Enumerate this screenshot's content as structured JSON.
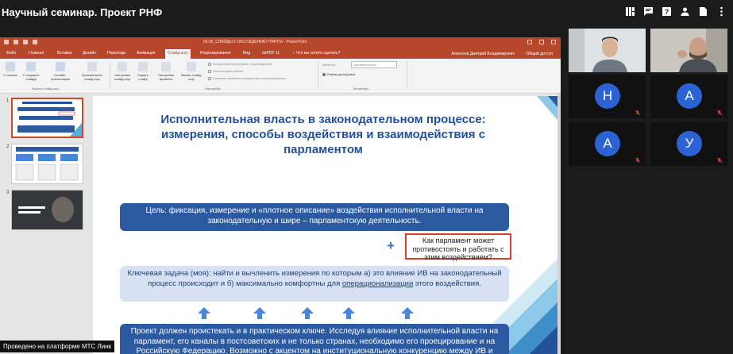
{
  "meeting": {
    "title": "Научный семинар. Проект РНФ",
    "footer": "Проведено на платформе МТС Линк"
  },
  "top_icons": [
    "grid-icon",
    "chat-icon",
    "help-icon",
    "user-icon",
    "document-icon",
    "more-icon"
  ],
  "powerpoint": {
    "document_title": "05.05_СЛАЙДЫ К ОБСУЖДЕНИЮ ГРАНТА - PowerPoint",
    "tabs": [
      "Файл",
      "Главная",
      "Вставка",
      "Дизайн",
      "Переходы",
      "Анимация",
      "Слайд-шоу",
      "Рецензирование",
      "Вид",
      "doPDF 11",
      "♀ Что вы хотите сделать?"
    ],
    "active_tab": "Слайд-шоу",
    "user": "Алексеев Дмитрий Владимирович",
    "share": "Общий доступ",
    "ribbon": {
      "buttons": [
        "С начала",
        "С текущего слайда",
        "Онлайн-презентация",
        "Произвольное слайд-шоу",
        "Настройка слайд-шоу",
        "Скрыть слайд",
        "Настройка времени",
        "Запись слайд-шоу"
      ],
      "checks": [
        "Воспроизвести речевое сопровождение",
        "Использовать время",
        "Показать элементы управления проигрывателем"
      ],
      "monitor_label": "Монитор:",
      "monitor_value": "Автоматически",
      "presenter_view": "Режим докладчика",
      "groups": [
        "Начать слайд-шоу",
        "Настройка",
        "Мониторы"
      ]
    },
    "thumb_numbers": [
      "1",
      "2",
      "3"
    ]
  },
  "slide": {
    "title": "Исполнительная власть в законодательном процессе: измерения, способы воздействия и взаимодействия с парламентом",
    "goal": "Цель: фиксация, измерение и «плотное описание» воздействия исполнительной власти на законодательную и шире – парламентскую деятельность.",
    "question": "Как парламент может противостоять и работать с этим воздействием?",
    "plus": "+",
    "task_before": "Ключевая задача (моя): найти и вычленить измерения по которым а) это влияние ИВ на законодательный процесс происходит и б) максимально комфортны для ",
    "task_underlined": "операционализации",
    "task_after": " этого воздействия.",
    "project": "Проект должен проистекать и в практическом ключе. Исследуя влияние исполнительной власти на парламент, его каналы в постсоветских и не только странах, необходимо его проецирование и на Российскую Федерацию. Возможно с акцентом на институциональную конкуренцию между ИВ и парламентом."
  },
  "participants": [
    {
      "type": "video",
      "name": "participant-video-1"
    },
    {
      "type": "video",
      "name": "participant-video-2"
    },
    {
      "type": "avatar",
      "initial": "Н",
      "muted": true
    },
    {
      "type": "avatar",
      "initial": "А",
      "muted": true
    },
    {
      "type": "avatar",
      "initial": "А",
      "muted": true
    },
    {
      "type": "avatar",
      "initial": "У",
      "muted": true
    }
  ],
  "colors": {
    "ppt_accent": "#b7472a",
    "slide_blue": "#2c5aa0",
    "title_blue": "#23509a",
    "avatar_blue": "#2c63d4",
    "highlight_red": "#e03a2a"
  }
}
